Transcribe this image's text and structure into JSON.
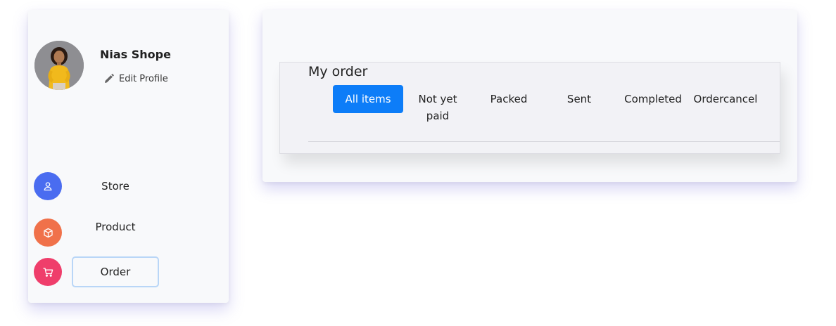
{
  "profile": {
    "name": "Nias Shope",
    "edit_label": "Edit Profile"
  },
  "nav": {
    "items": [
      {
        "label": "Store",
        "icon": "user-icon",
        "color": "#4a6cf0"
      },
      {
        "label": "Product",
        "icon": "box-icon",
        "color": "#f0714a"
      },
      {
        "label": "Order",
        "icon": "cart-icon",
        "color": "#ef3e6b",
        "selected": true
      }
    ]
  },
  "orders": {
    "title": "My order",
    "tabs": [
      {
        "label": "All items",
        "active": true
      },
      {
        "label": "Not yet paid"
      },
      {
        "label": "Packed"
      },
      {
        "label": "Sent"
      },
      {
        "label": "Completed"
      },
      {
        "label": "Ordercancel"
      }
    ],
    "active_color": "#0d7df8"
  }
}
